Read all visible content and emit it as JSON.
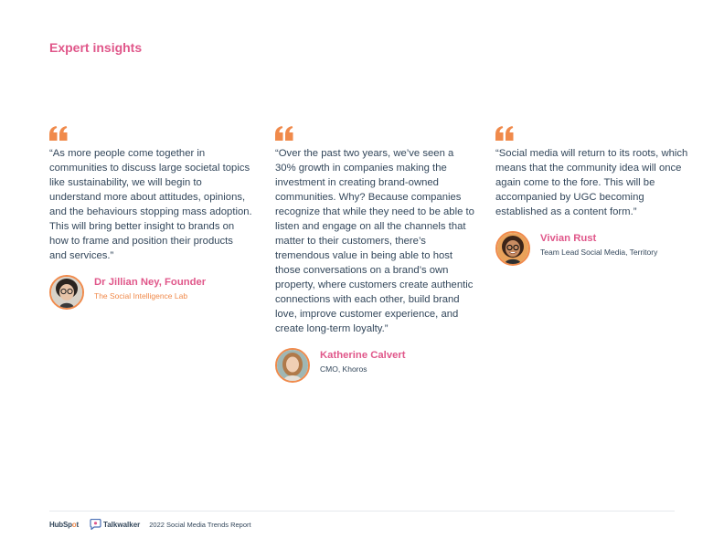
{
  "section_title": "Expert insights",
  "colors": {
    "accent_pink": "#e0578a",
    "accent_orange": "#f08a4b",
    "text": "#33475b"
  },
  "quotes": [
    {
      "text": "“As more people come together in communities to discuss large societal topics like sustainability, we will begin to understand more about attitudes, opinions, and the behaviours stopping mass adoption. This will bring better insight to brands on how to frame and position their products and services.”",
      "name": "Dr Jillian Ney, Founder",
      "role": "The Social Intelligence Lab"
    },
    {
      "text": "“Over the past two years, we’ve seen a 30% growth in companies making the investment in creating brand-owned communities. Why? Because companies recognize that while they need to be able to listen and engage on all the channels that matter to their customers, there’s tremendous value in being able to host those conversations on a brand’s own property, where customers create authentic connections with each other, build brand love, improve customer experience, and create long-term loyalty.”",
      "name": "Katherine Calvert",
      "role": "CMO, Khoros"
    },
    {
      "text": "“Social media will return to its roots, which means that the community idea will once again come to the fore. This will be accompanied by UGC becoming established as a content form.”",
      "name": "Vivian Rust",
      "role": "Team Lead Social Media, Territory"
    }
  ],
  "footer": {
    "hubspot_a": "HubSp",
    "hubspot_o": "o",
    "hubspot_b": "t",
    "talkwalker": "Talkwalker",
    "report": "2022 Social Media Trends Report"
  }
}
